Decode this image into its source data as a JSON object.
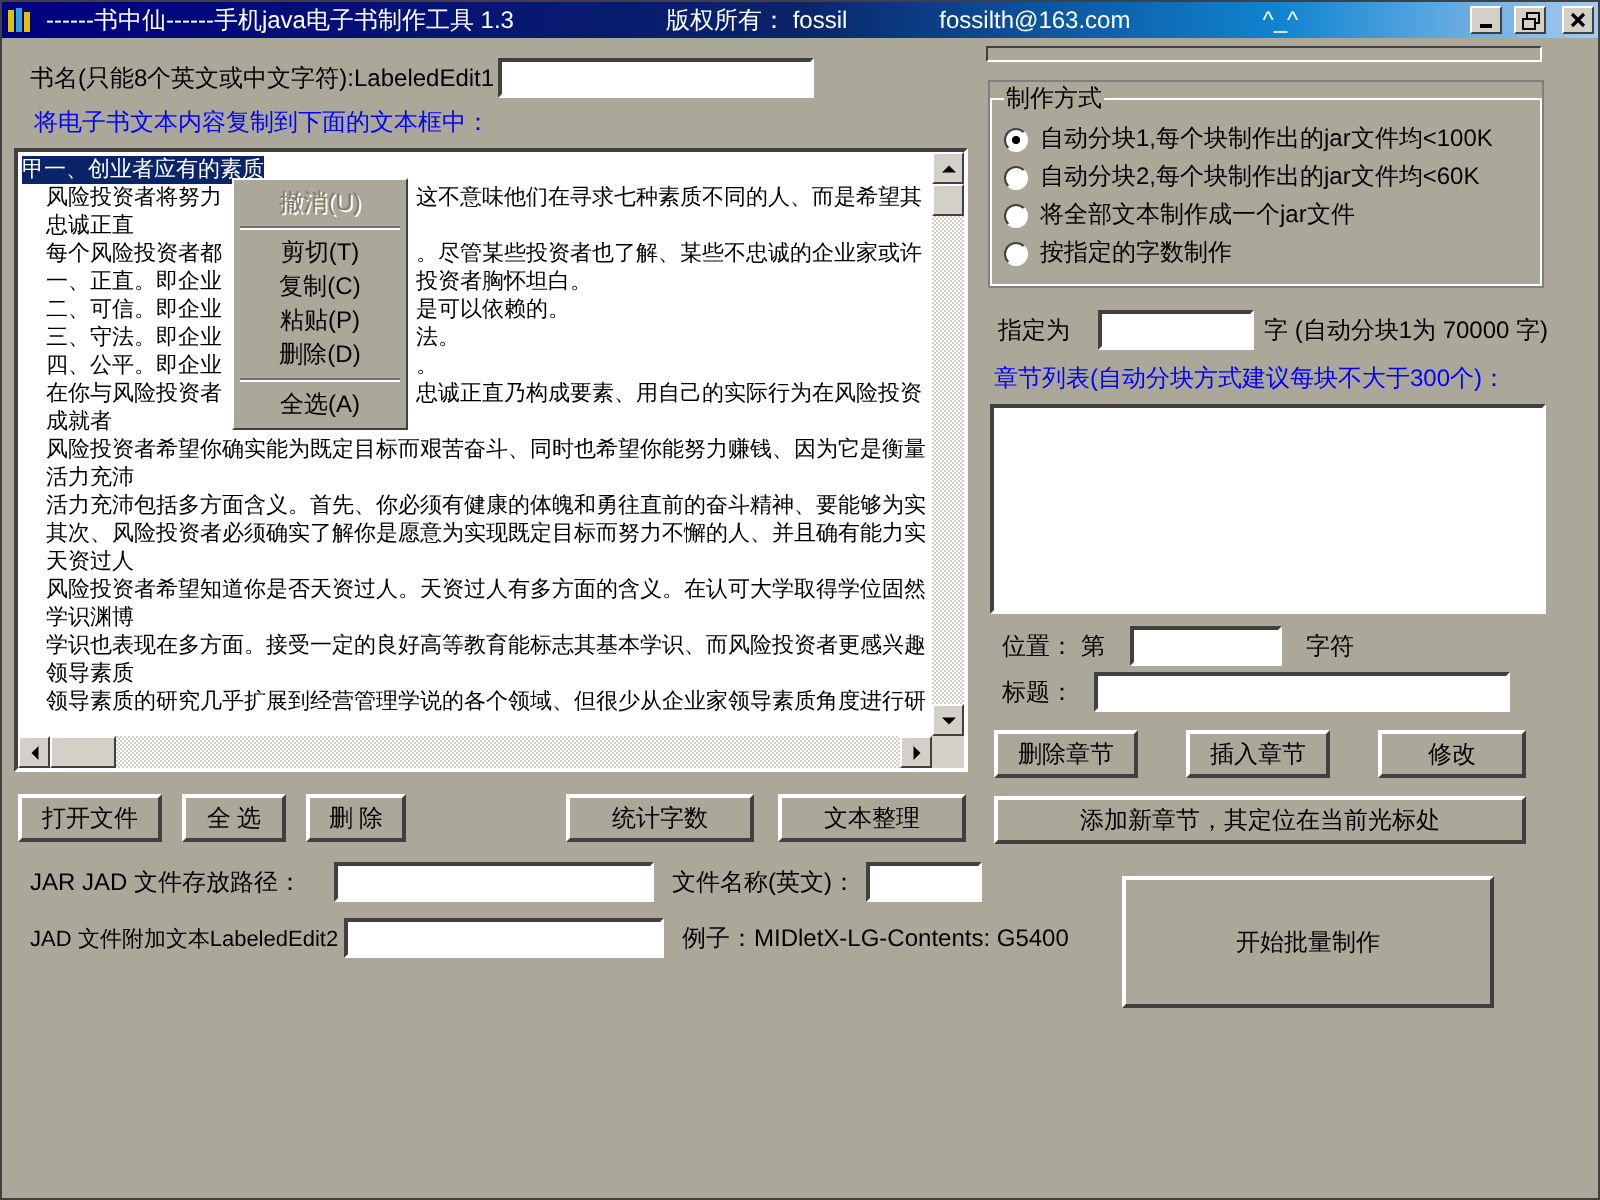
{
  "window": {
    "title": "------书中仙------手机java电子书制作工具  1.3",
    "copyright": "版权所有： fossil",
    "email": "fossilth@163.com",
    "smiley": "^_^"
  },
  "book_name": {
    "label": "书名(只能8个英文或中文字符):LabeledEdit1"
  },
  "memo": {
    "caption": "将电子书文本内容复制到下面的文本框中：",
    "lines": [
      {
        "text": "甲一、创业者应有的素质",
        "indented": false,
        "selected": true
      },
      {
        "text": "风险投资者将努力",
        "rest": "这不意味他们在寻求七种素质不同的人、而是希望其",
        "indented": true,
        "selected": false
      },
      {
        "text": "忠诚正直",
        "indented": true,
        "selected": false
      },
      {
        "text": "每个风险投资者都",
        "rest": "。尽管某些投资者也了解、某些不忠诚的企业家或许",
        "indented": true,
        "selected": false
      },
      {
        "text": "一、正直。即企业",
        "rest": "投资者胸怀坦白。",
        "indented": true,
        "selected": false
      },
      {
        "text": "二、可信。即企业",
        "rest": "是可以依赖的。",
        "indented": true,
        "selected": false
      },
      {
        "text": "三、守法。即企业",
        "rest": "法。",
        "indented": true,
        "selected": false
      },
      {
        "text": "四、公平。即企业",
        "rest": "。",
        "indented": true,
        "selected": false
      },
      {
        "text": "在你与风险投资者",
        "rest": "忠诚正直乃构成要素、用自己的实际行为在风险投资",
        "indented": true,
        "selected": false
      },
      {
        "text": "成就者",
        "indented": true,
        "selected": false
      },
      {
        "text": "风险投资者希望你确实能为既定目标而艰苦奋斗、同时也希望你能努力赚钱、因为它是衡量",
        "indented": true,
        "selected": false
      },
      {
        "text": "活力充沛",
        "indented": true,
        "selected": false
      },
      {
        "text": "活力充沛包括多方面含义。首先、你必须有健康的体魄和勇往直前的奋斗精神、要能够为实",
        "indented": true,
        "selected": false
      },
      {
        "text": "其次、风险投资者必须确实了解你是愿意为实现既定目标而努力不懈的人、并且确有能力实",
        "indented": true,
        "selected": false
      },
      {
        "text": "天资过人",
        "indented": true,
        "selected": false
      },
      {
        "text": "风险投资者希望知道你是否天资过人。天资过人有多方面的含义。在认可大学取得学位固然",
        "indented": true,
        "selected": false
      },
      {
        "text": "学识渊博",
        "indented": true,
        "selected": false
      },
      {
        "text": "学识也表现在多方面。接受一定的良好高等教育能标志其基本学识、而风险投资者更感兴趣",
        "indented": true,
        "selected": false
      },
      {
        "text": "领导素质",
        "indented": true,
        "selected": false
      },
      {
        "text": "领导素质的研究几乎扩展到经营管理学说的各个领域、但很少从企业家领导素质角度进行研",
        "indented": true,
        "selected": false
      }
    ]
  },
  "context_menu": [
    {
      "kind": "item",
      "label": "撤消(U)",
      "disabled": true
    },
    {
      "kind": "separator"
    },
    {
      "kind": "item",
      "label": "剪切(T)",
      "disabled": false
    },
    {
      "kind": "item",
      "label": "复制(C)",
      "disabled": false
    },
    {
      "kind": "item",
      "label": "粘贴(P)",
      "disabled": false
    },
    {
      "kind": "item",
      "label": "删除(D)",
      "disabled": false
    },
    {
      "kind": "separator"
    },
    {
      "kind": "item",
      "label": "全选(A)",
      "disabled": false
    }
  ],
  "left_buttons": [
    "打开文件",
    "全 选",
    "删 除"
  ],
  "right_buttons": [
    "统计字数",
    "文本整理"
  ],
  "jar_path": {
    "label": "JAR  JAD  文件存放路径：",
    "file_label": "文件名称(英文)："
  },
  "jad_text": {
    "label": "JAD 文件附加文本LabeledEdit2",
    "example": "例子：MIDletX-LG-Contents: G5400"
  },
  "mode_group": {
    "title": "制作方式",
    "options": [
      {
        "label": "自动分块1,每个块制作出的jar文件均<100K",
        "selected": true
      },
      {
        "label": "自动分块2,每个块制作出的jar文件均<60K",
        "selected": false
      },
      {
        "label": "将全部文本制作成一个jar文件",
        "selected": false
      },
      {
        "label": "按指定的字数制作",
        "selected": false
      }
    ]
  },
  "specify": {
    "label": "指定为",
    "suffix": "字 (自动分块1为 70000 字)"
  },
  "chapters": {
    "caption": "章节列表(自动分块方式建议每块不大于300个)："
  },
  "position": {
    "label": "位置： 第",
    "suffix": "字符"
  },
  "title_field": {
    "label": "标题："
  },
  "chapter_buttons": [
    "删除章节",
    "插入章节",
    "修改"
  ],
  "add_button": "添加新章节，其定位在当前光标处",
  "start_button": "开始批量制作"
}
